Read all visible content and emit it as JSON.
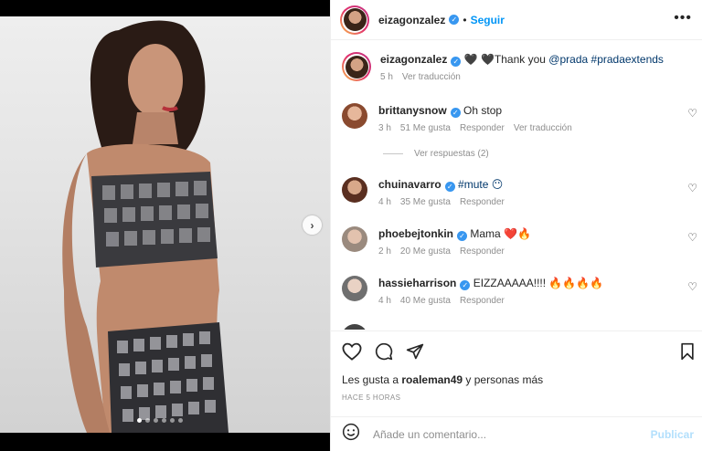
{
  "post": {
    "username": "eizagonzalez",
    "verified_icon": "verified-badge-icon",
    "follow_label": "Seguir",
    "dot": "•",
    "more_icon": "more-options-icon",
    "caption_prefix": "🖤 🖤Thank you ",
    "caption_mention": "@prada",
    "caption_tag": "#pradaextends",
    "caption_time": "5 h",
    "caption_translate": "Ver traducción"
  },
  "comments": [
    {
      "username": "brittanysnow",
      "text": "Oh stop",
      "time": "3 h",
      "likes": "51 Me gusta",
      "reply": "Responder",
      "translate": "Ver traducción"
    },
    {
      "username": "chuinavarro",
      "text": "#mute 😶",
      "time": "4 h",
      "likes": "35 Me gusta",
      "reply": "Responder"
    },
    {
      "username": "phoebejtonkin",
      "text": "Mama ❤️🔥",
      "time": "2 h",
      "likes": "20 Me gusta",
      "reply": "Responder"
    },
    {
      "username": "hassieharrison",
      "text": "EIZZAAAAA!!!! 🔥🔥🔥🔥",
      "time": "4 h",
      "likes": "40 Me gusta",
      "reply": "Responder"
    }
  ],
  "view_replies": "Ver respuestas (2)",
  "likes": {
    "prefix": "Les gusta a ",
    "user": "roaleman49",
    "suffix": " y personas más"
  },
  "timestamp": "HACE 5 HORAS",
  "add_comment": {
    "placeholder": "Añade un comentario...",
    "publish": "Publicar"
  },
  "colors": {
    "accent": "#0095f6",
    "verified": "#3897f0",
    "muted": "#8e8e8e"
  }
}
